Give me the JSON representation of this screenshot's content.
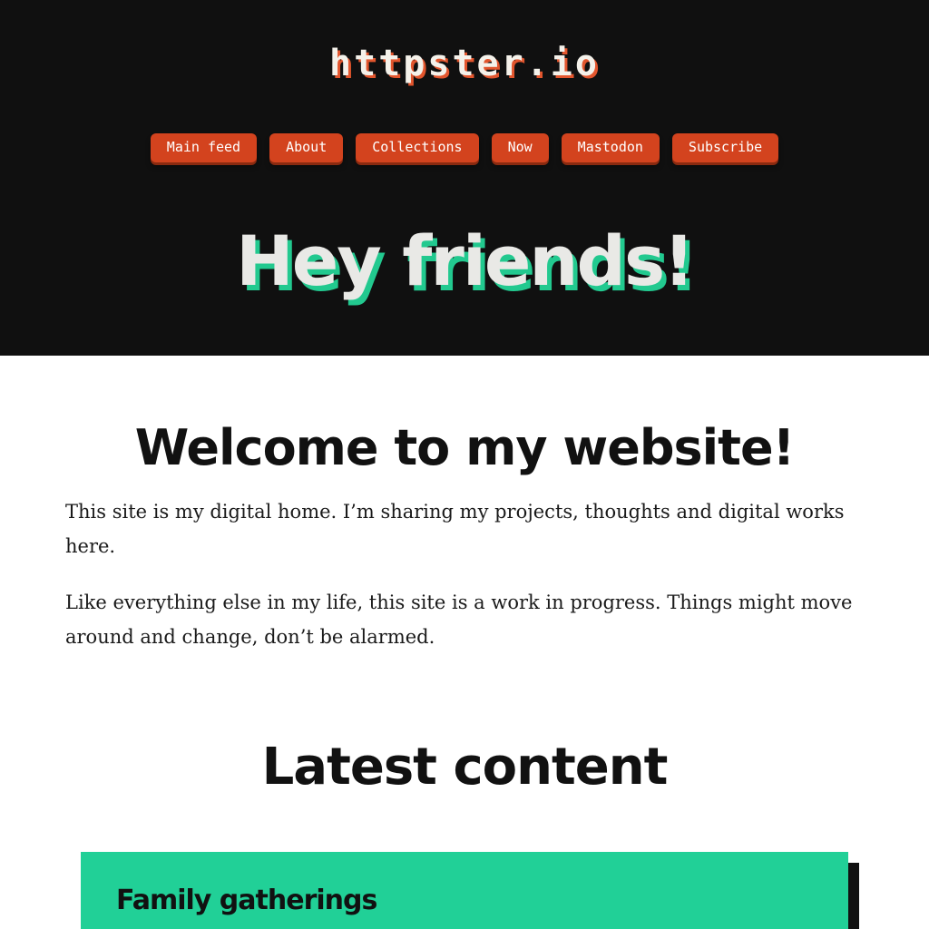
{
  "header": {
    "site_title": "httpster.io",
    "nav": [
      {
        "label": "Main feed"
      },
      {
        "label": "About"
      },
      {
        "label": "Collections"
      },
      {
        "label": "Now"
      },
      {
        "label": "Mastodon"
      },
      {
        "label": "Subscribe"
      }
    ],
    "hero_heading": "Hey friends!"
  },
  "main": {
    "welcome_heading": "Welcome to my website!",
    "paragraphs": [
      "This site is my digital home. I’m sharing my projects, thoughts and digital works here.",
      "Like everything else in my life, this site is a work in progress. Things might move around and change, don’t be alarmed."
    ],
    "latest_heading": "Latest content",
    "cards": [
      {
        "title": "Family gatherings"
      }
    ]
  },
  "colors": {
    "hero_background": "#101010",
    "nav_button": "#d3431e",
    "hero_heading_shadow": "#22c98f",
    "card_background": "#21d097"
  }
}
